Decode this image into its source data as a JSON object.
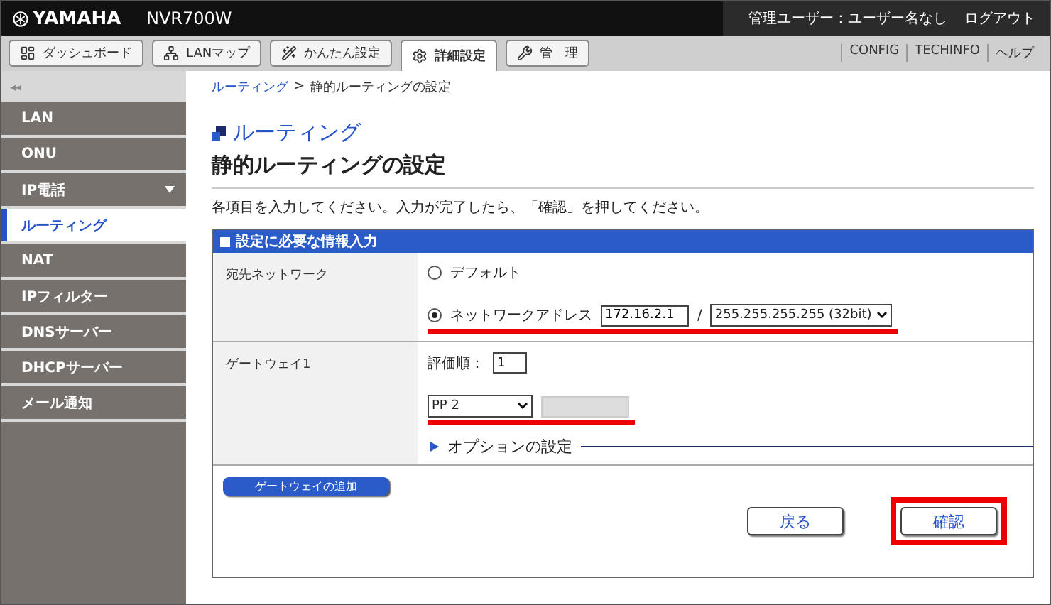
{
  "header": {
    "brand": "YAMAHA",
    "model": "NVR700W",
    "user": "管理ユーザー：ユーザー名なし",
    "logout": "ログアウト"
  },
  "tabs": [
    {
      "label": "ダッシュボード",
      "kind": "dashboard",
      "selected": false
    },
    {
      "label": "LANマップ",
      "kind": "map",
      "selected": false
    },
    {
      "label": "かんたん設定",
      "kind": "wizard",
      "selected": false
    },
    {
      "label": "詳細設定",
      "kind": "gear",
      "selected": true
    },
    {
      "label": "管　理",
      "kind": "wrench",
      "selected": false
    }
  ],
  "top_links": [
    "CONFIG",
    "TECHINFO",
    "ヘルプ"
  ],
  "collapse": "◂◂",
  "breadcrumb": {
    "link": "ルーティング",
    "separator": ">",
    "current": "静的ルーティングの設定"
  },
  "sidebar": {
    "items": [
      {
        "label": "LAN",
        "selected": false,
        "expandable": false
      },
      {
        "label": "ONU",
        "selected": false,
        "expandable": false
      },
      {
        "label": "IP電話",
        "selected": false,
        "expandable": true
      },
      {
        "label": "ルーティング",
        "selected": true,
        "expandable": false
      },
      {
        "label": "NAT",
        "selected": false,
        "expandable": false
      },
      {
        "label": "IPフィルター",
        "selected": false,
        "expandable": false
      },
      {
        "label": "DNSサーバー",
        "selected": false,
        "expandable": false
      },
      {
        "label": "DHCPサーバー",
        "selected": false,
        "expandable": false
      },
      {
        "label": "メール通知",
        "selected": false,
        "expandable": false
      }
    ]
  },
  "section_title": "ルーティング",
  "page_title": "静的ルーティングの設定",
  "instruction": "各項目を入力してください。入力が完了したら、「確認」を押してください。",
  "panel": {
    "title": "設定に必要な情報入力",
    "destination": {
      "label": "宛先ネットワーク",
      "options": [
        {
          "label": "デフォルト",
          "selected": false
        },
        {
          "label": "ネットワークアドレス",
          "selected": true
        }
      ],
      "address": "172.16.2.1",
      "slash": "/",
      "mask": "255.255.255.255 (32bit)",
      "highlighted": true
    },
    "gateway": {
      "label": "ゲートウェイ1",
      "priority_label": "評価順：",
      "priority": "1",
      "interface": "PP 2",
      "highlighted": true,
      "ip_disabled": true,
      "options_label": "オプションの設定"
    },
    "add_button": "ゲートウェイの追加",
    "back_button": "戻る",
    "confirm_button": {
      "label": "確認",
      "highlighted": true
    }
  }
}
